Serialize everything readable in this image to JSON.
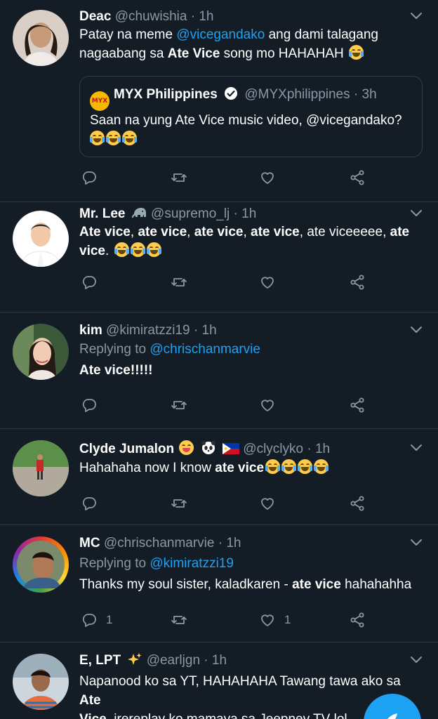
{
  "tweets": [
    {
      "name": "Deac",
      "handle": "@chuwishia",
      "dot": "·",
      "time": "1h",
      "text_parts": {
        "a": "Patay na meme ",
        "mention": "@vicegandako",
        "b": " ang dami talagang nagaabang sa ",
        "bold": "Ate Vice",
        "c": " song mo HAHAHAH"
      },
      "quote": {
        "logo_text": "MYX",
        "name": "MYX Philippines",
        "handle": "@MYXphilippines",
        "dot": "·",
        "time": "3h",
        "text": "Saan na yung Ate Vice music video, @vicegandako?"
      },
      "reply_count": "",
      "like_count": ""
    },
    {
      "name": "Mr. Lee",
      "handle": "@supremo_lj",
      "dot": "·",
      "time": "1h",
      "text_parts": {
        "b1": "Ate vice",
        "s1": ", ",
        "b2": "ate vice",
        "s2": ", ",
        "b3": "ate vice",
        "s3": ", ",
        "b4": "ate vice",
        "s4": ", ate viceeeee, ",
        "b5": "ate",
        "b6": "vice",
        "s5": ". "
      }
    },
    {
      "name": "kim",
      "handle": "@kimiratzzi19",
      "dot": "·",
      "time": "1h",
      "reply_label": "Replying to ",
      "reply_mention": "@chrischanmarvie",
      "text": "Ate vice!!!!!"
    },
    {
      "name": "Clyde Jumalon",
      "handle": "@clyclyko",
      "dot": "·",
      "time": "1h",
      "text_a": "Hahahaha now I know ",
      "text_bold": "ate vice"
    },
    {
      "name": "MC",
      "handle": "@chrischanmarvie",
      "dot": "·",
      "time": "1h",
      "reply_label": "Replying to ",
      "reply_mention": "@kimiratzzi19",
      "text_a": "Thanks my soul sister, kaladkaren - ",
      "text_bold": "ate vice",
      "text_c": " hahahahha",
      "reply_count": "1",
      "like_count": "1"
    },
    {
      "name": "E, LPT",
      "handle": "@earljgn",
      "dot": "·",
      "time": "1h",
      "text_a": "Napanood ko sa YT, HAHAHAHA Tawang tawa ako sa ",
      "text_bold1": "Ate",
      "text_bold2": "Vice",
      "text_c": ", irereplay ko mamaya sa Jeepney TV lol"
    }
  ],
  "colors": {
    "background": "#141d26",
    "accent": "#1da1f2",
    "muted": "#8899a6",
    "divider": "#2a3643"
  },
  "icons": [
    "reply-icon",
    "retweet-icon",
    "like-icon",
    "share-icon",
    "caret-down-icon",
    "verified-badge-icon",
    "compose-tweet-icon"
  ]
}
